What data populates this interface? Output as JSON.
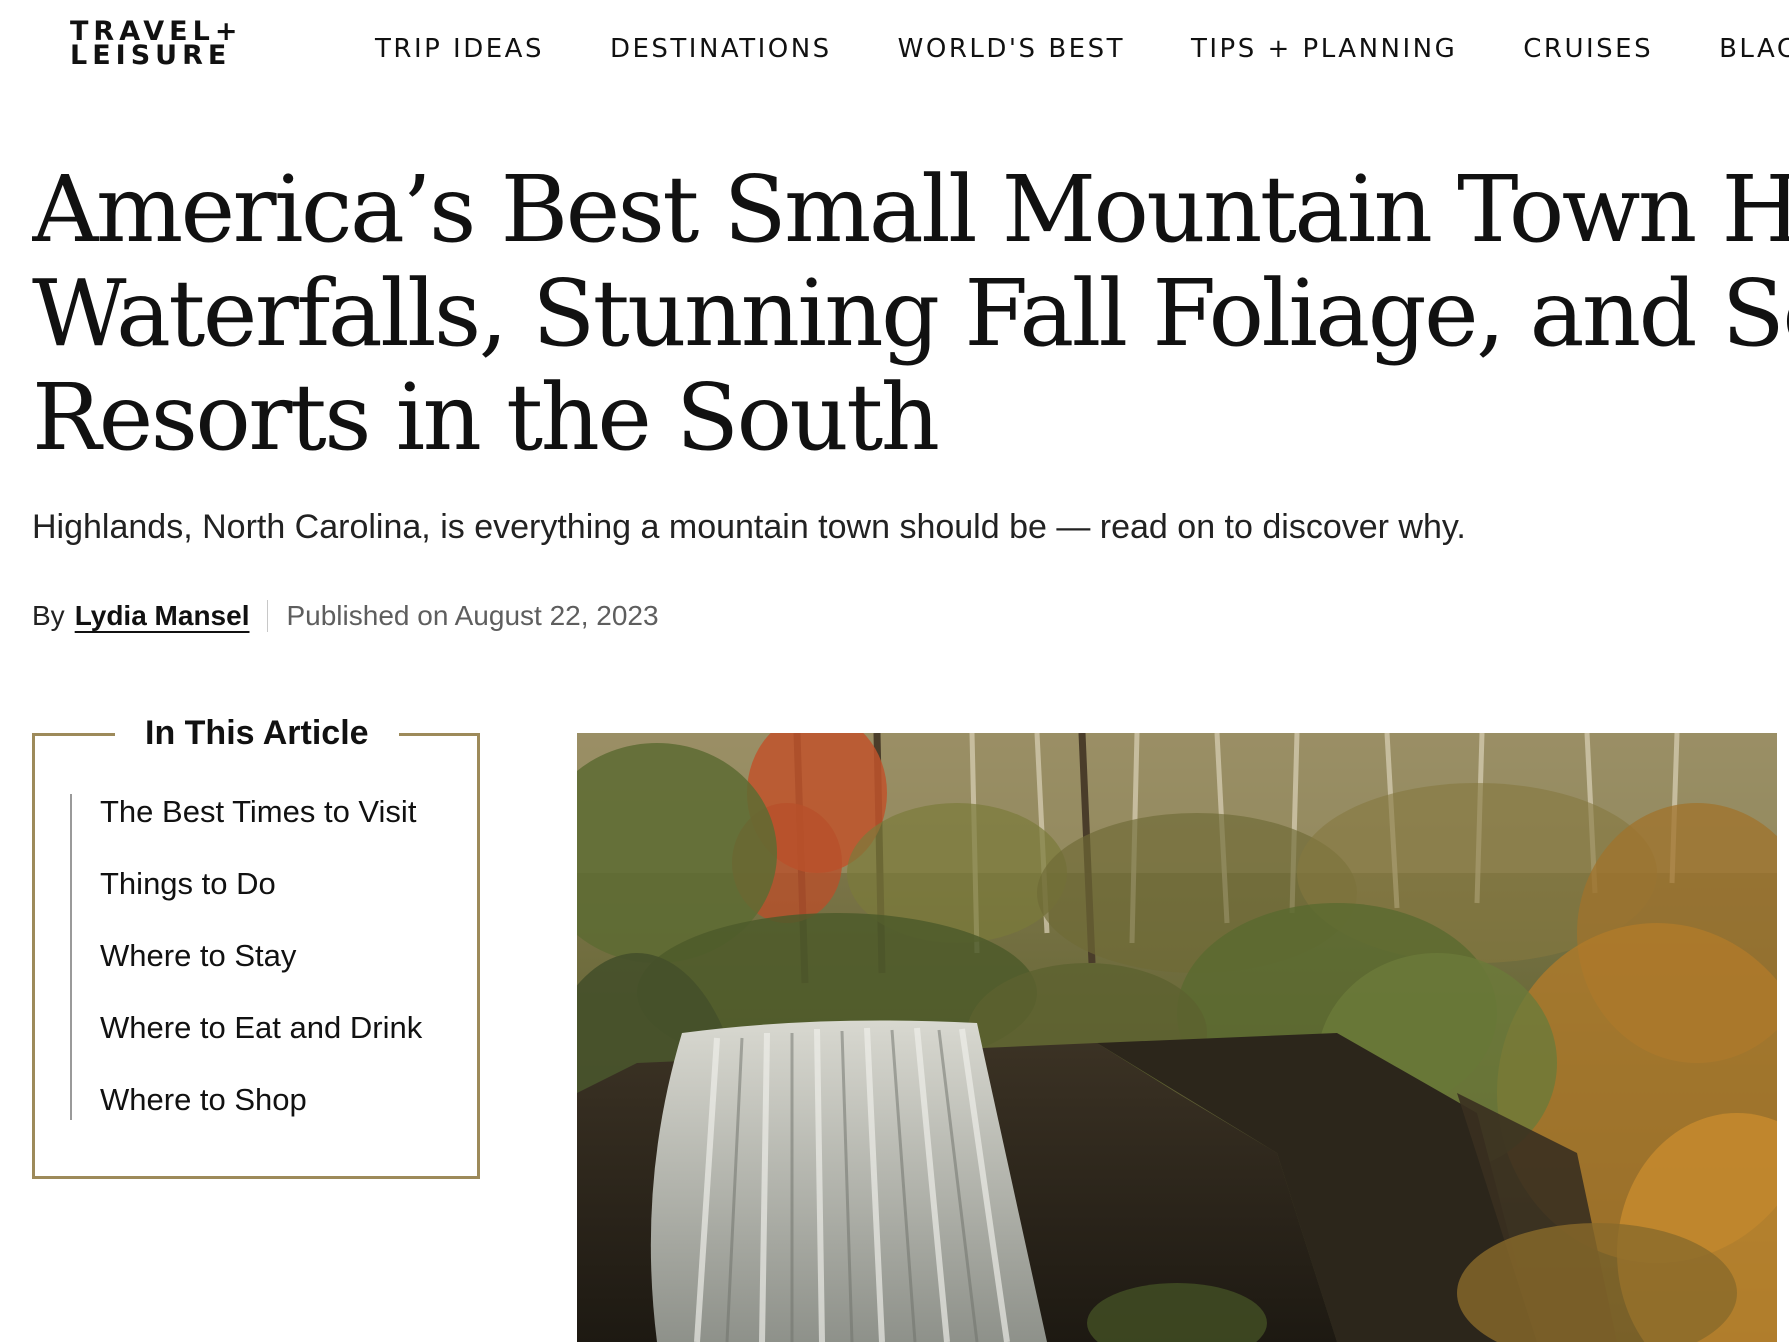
{
  "header": {
    "logo": {
      "line1": "TRAVEL+",
      "line2": "LEISURE"
    },
    "nav": [
      "TRIP IDEAS",
      "DESTINATIONS",
      "WORLD'S BEST",
      "TIPS + PLANNING",
      "CRUISES",
      "BLACK"
    ]
  },
  "article": {
    "title_lines": [
      "America’s Best Small Mountain Town Has B",
      "Waterfalls, Stunning Fall Foliage, and Some",
      "Resorts in the South"
    ],
    "subtitle": "Highlands, North Carolina, is everything a mountain town should be — read on to discover why.",
    "byline": {
      "prefix": "By",
      "author": "Lydia Mansel",
      "published": "Published on August 22, 2023"
    }
  },
  "toc": {
    "title": "In This Article",
    "items": [
      "The Best Times to Visit",
      "Things to Do",
      "Where to Stay",
      "Where to Eat and Drink",
      "Where to Shop"
    ]
  },
  "hero": {
    "icon": "waterfall-autumn-forest-photo",
    "colors": {
      "accent_border": "#9d8a5a"
    }
  }
}
